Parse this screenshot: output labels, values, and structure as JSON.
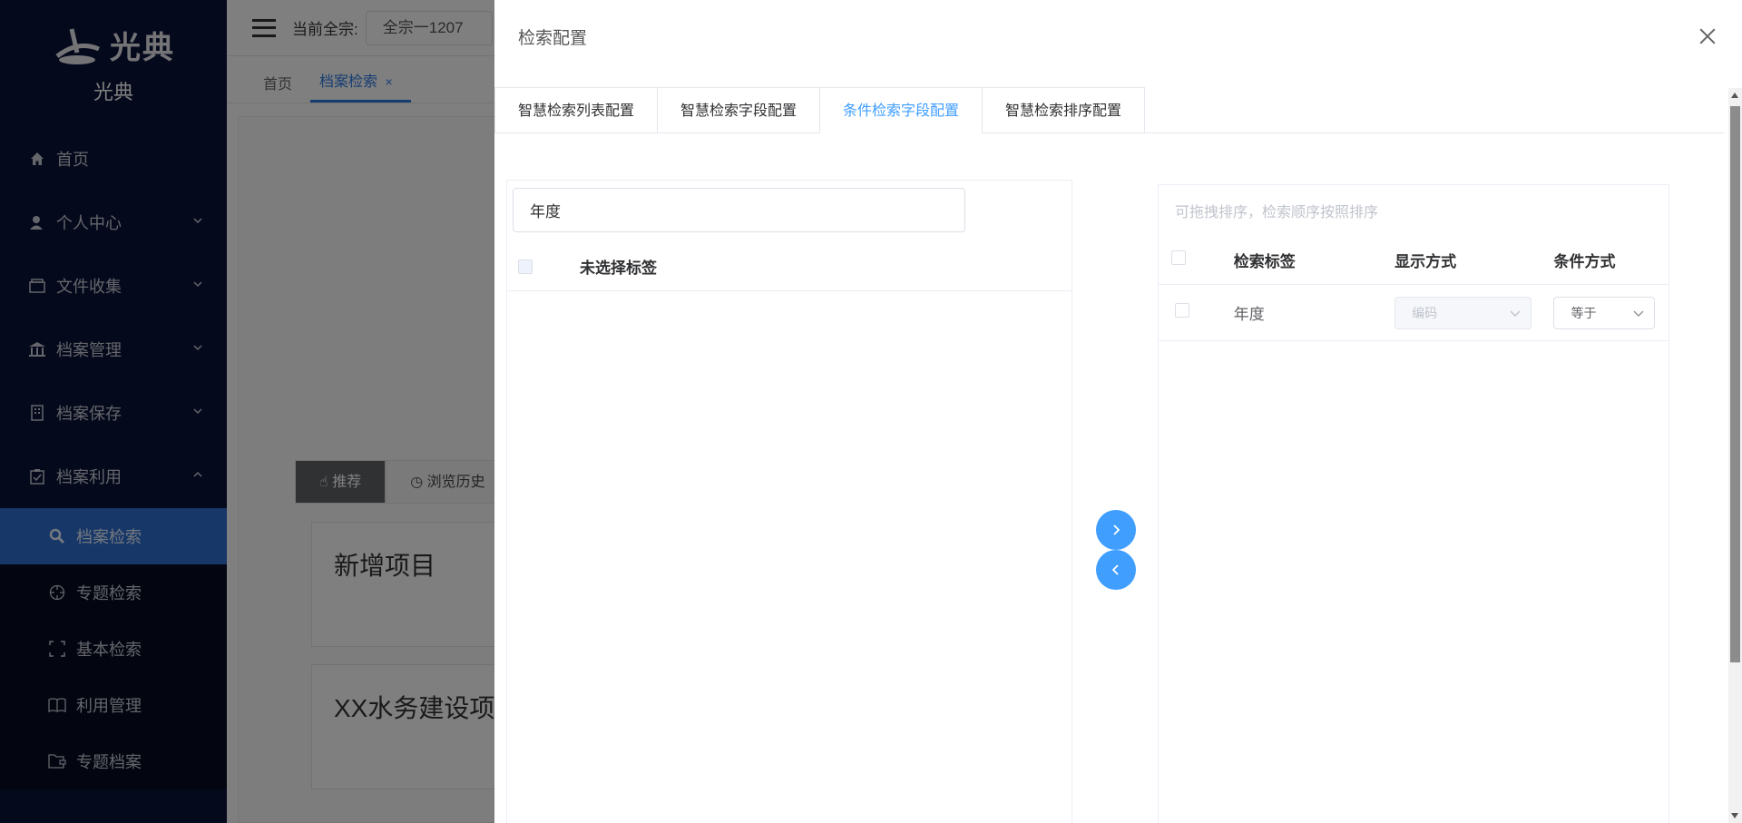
{
  "sidebar": {
    "logo_text": "光典",
    "logo_sub": "光典",
    "items": [
      {
        "label": "首页",
        "icon": "home-icon"
      },
      {
        "label": "个人中心",
        "icon": "user-icon"
      },
      {
        "label": "文件收集",
        "icon": "folder-icon"
      },
      {
        "label": "档案管理",
        "icon": "bank-icon"
      },
      {
        "label": "档案保存",
        "icon": "building-icon"
      },
      {
        "label": "档案利用",
        "icon": "clipboard-icon"
      }
    ],
    "subitems": [
      {
        "label": "档案检索",
        "icon": "search-icon",
        "active": true
      },
      {
        "label": "专题检索",
        "icon": "target-icon"
      },
      {
        "label": "基本检索",
        "icon": "scan-icon"
      },
      {
        "label": "利用管理",
        "icon": "book-icon"
      },
      {
        "label": "专题档案",
        "icon": "folder-tag-icon"
      }
    ]
  },
  "topbar": {
    "current_label": "当前全宗:",
    "current_value": "全宗一1207"
  },
  "tags": [
    {
      "label": "首页"
    },
    {
      "label": "档案检索"
    }
  ],
  "background": {
    "rec_tabs": [
      "推荐",
      "浏览历史"
    ],
    "cards": [
      "新增项目",
      "XX水务建设项"
    ]
  },
  "drawer": {
    "title": "检索配置",
    "tabs": [
      "智慧检索列表配置",
      "智慧检索字段配置",
      "条件检索字段配置",
      "智慧检索排序配置"
    ],
    "active_tab": 2,
    "left": {
      "search_value": "年度",
      "header": "未选择标签"
    },
    "right": {
      "hint": "可拖拽排序，检索顺序按照排序",
      "columns": [
        "检索标签",
        "显示方式",
        "条件方式"
      ],
      "rows": [
        {
          "label": "年度",
          "display": "编码",
          "condition": "等于"
        }
      ]
    }
  },
  "colors": {
    "primary": "#409eff",
    "sidebar_bg": "#0a1338",
    "sidebar_active": "#2d6fd1"
  }
}
